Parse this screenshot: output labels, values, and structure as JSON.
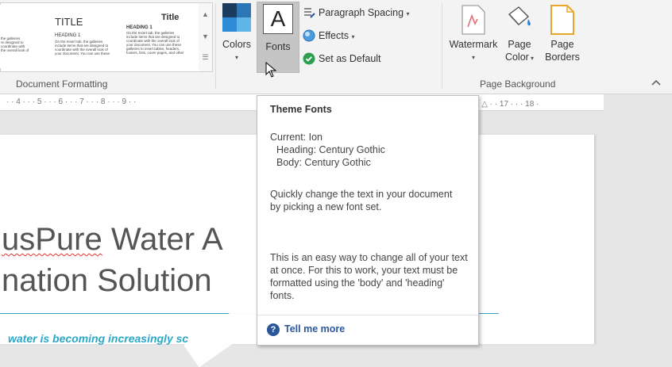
{
  "ribbon": {
    "gallery": [
      {
        "title": "",
        "heading": "",
        "text": "the galleries\nre designed to\ncoordinate with\nthe overall look of"
      },
      {
        "title": "TITLE",
        "heading": "HEADING 1",
        "text": "On the Insert tab, the galleries\ninclude items that are designed to\ncoordinate with the overall look of\nyour document. You can use these"
      },
      {
        "title": "Title",
        "heading": "HEADING 1",
        "text": "On the Insert tab, the galleries\ninclude items that are designed to\ncoordinate with the overall look of\nyour document. You can use these\ngalleries to insert tables, headers,\nfooters, lists, cover pages, and other"
      }
    ],
    "colors_label": "Colors",
    "fonts_label": "Fonts",
    "paragraph_spacing_label": "Paragraph Spacing",
    "effects_label": "Effects",
    "set_default_label": "Set as Default",
    "document_formatting_label": "Document Formatting",
    "watermark_label": "Watermark",
    "page_color_label_1": "Page",
    "page_color_label_2": "Color",
    "page_borders_label_1": "Page",
    "page_borders_label_2": "Borders",
    "page_background_label": "Page Background",
    "collapse_icon": "chevron-up-icon"
  },
  "ruler": {
    "left": "· · 4 · · · 5 · · · 6 · · · 7 · · · 8 · · · 9 · ·",
    "right": "· · △ · · 17 · · · 18 ·"
  },
  "document": {
    "line1_a": "usPure",
    "line1_b": " Water A",
    "line2": "nation Solution",
    "subtitle": "water is becoming increasingly sc"
  },
  "tooltip": {
    "title": "Theme Fonts",
    "current": "Current: Ion",
    "heading_font": "Heading: Century Gothic",
    "body_font": "Body: Century Gothic",
    "desc1": "Quickly change the text in your document by picking a new font set.",
    "desc2": "This is an easy way to change all of your text at once. For this to work, your text must be formatted using the 'body' and 'heading' fonts.",
    "link": "Tell me more"
  },
  "colors": {
    "accent": "#2b579a",
    "doc_accent": "#2aa8c6",
    "check_green": "#2e9e4f"
  }
}
